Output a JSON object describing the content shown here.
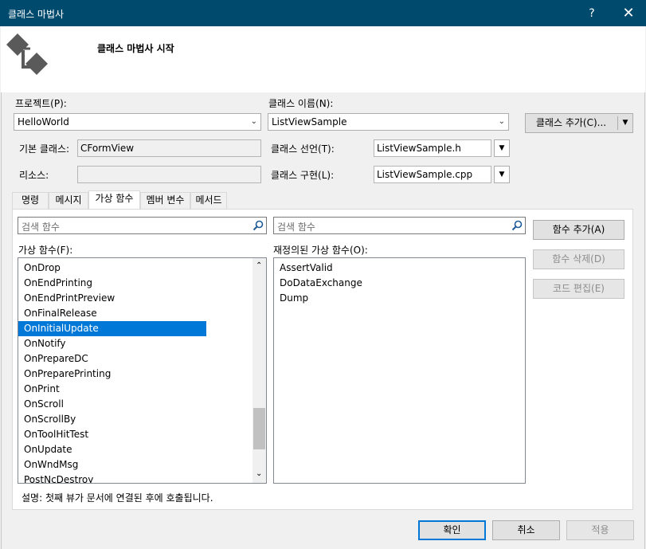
{
  "window": {
    "title": "클래스 마법사",
    "help_label": "?",
    "close_label": "✕"
  },
  "header": {
    "title": "클래스 마법사 시작",
    "logo_icon": "class-wizard-logo-icon"
  },
  "form": {
    "project_label": "프로젝트(P):",
    "project_value": "HelloWorld",
    "class_name_label": "클래스 이름(N):",
    "class_name_value": "ListViewSample",
    "add_class_label": "클래스 추가(C)...",
    "base_class_label": "기본 클래스:",
    "base_class_value": "CFormView",
    "resource_label": "리소스:",
    "resource_value": "",
    "class_decl_label": "클래스 선언(T):",
    "class_decl_value": "ListViewSample.h",
    "class_impl_label": "클래스 구현(L):",
    "class_impl_value": "ListViewSample.cpp"
  },
  "tabs": [
    {
      "label": "명령",
      "active": false
    },
    {
      "label": "메시지",
      "active": false
    },
    {
      "label": "가상 함수",
      "active": true
    },
    {
      "label": "멤버 변수",
      "active": false
    },
    {
      "label": "메서드",
      "active": false
    }
  ],
  "virtual_functions": {
    "search_placeholder": "검색 함수",
    "list_label": "가상 함수(F):",
    "items": [
      "OnDrop",
      "OnEndPrinting",
      "OnEndPrintPreview",
      "OnFinalRelease",
      "OnInitialUpdate",
      "OnNotify",
      "OnPrepareDC",
      "OnPreparePrinting",
      "OnPrint",
      "OnScroll",
      "OnScrollBy",
      "OnToolHitTest",
      "OnUpdate",
      "OnWndMsg",
      "PostNcDestroy"
    ],
    "selected": "OnInitialUpdate"
  },
  "overridden_functions": {
    "search_placeholder": "검색 함수",
    "list_label": "재정의된 가상 함수(O):",
    "items": [
      "AssertValid",
      "DoDataExchange",
      "Dump"
    ]
  },
  "side_buttons": {
    "add_function": "함수 추가(A)",
    "delete_function": "함수 삭제(D)",
    "edit_code": "코드 편집(E)"
  },
  "description": "설명:  첫째 뷰가 문서에 연결된 후에 호출됩니다.",
  "footer": {
    "ok": "확인",
    "cancel": "취소",
    "apply": "적용"
  },
  "colors": {
    "titlebar": "#004a6e",
    "selection": "#0078d7"
  }
}
